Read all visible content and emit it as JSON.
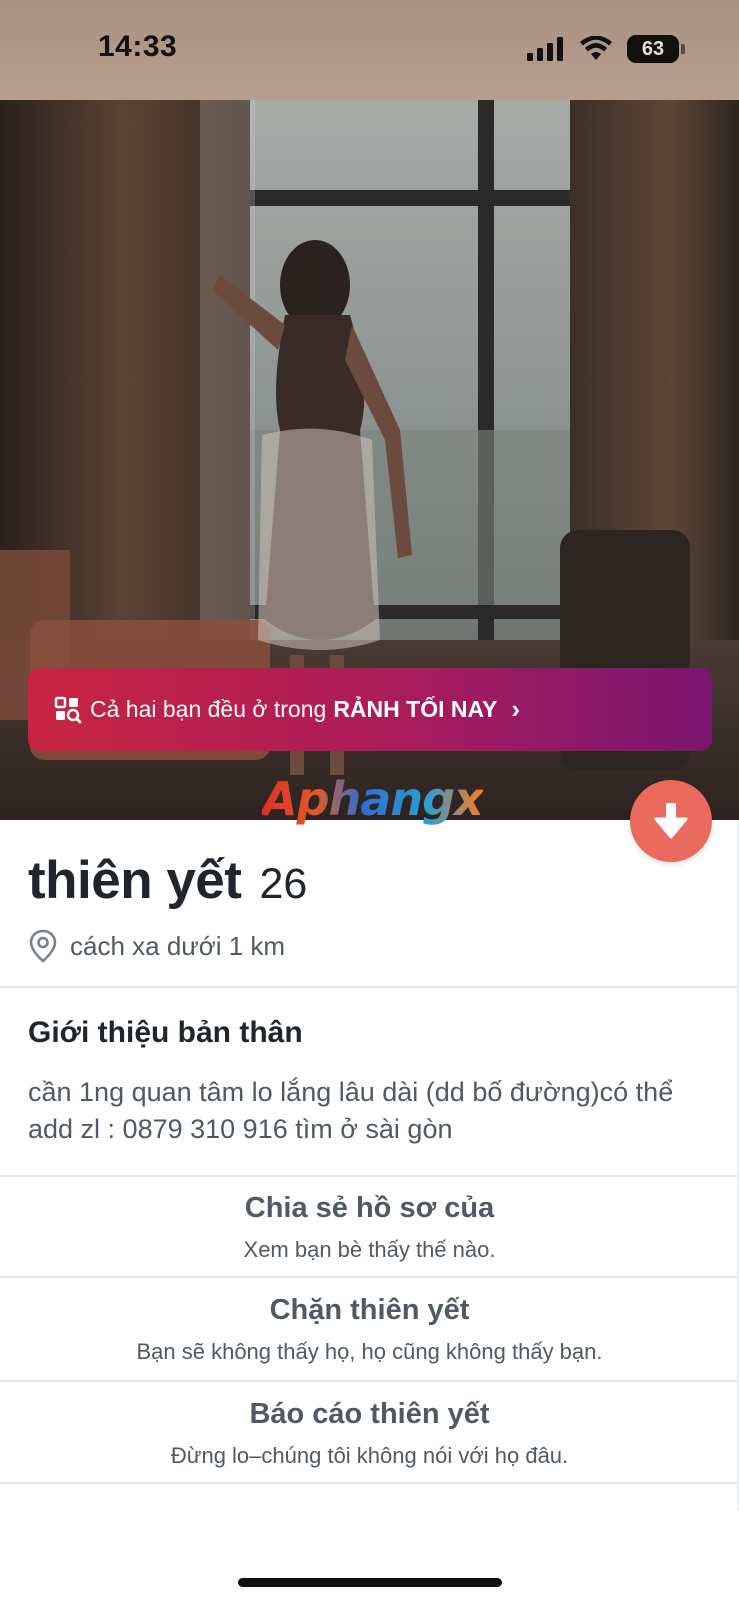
{
  "status_bar": {
    "time": "14:33",
    "battery": "63"
  },
  "promo_banner": {
    "text": "Cả hai bạn đều ở trong",
    "highlight": "RẢNH TỐI NAY",
    "chevron": "›"
  },
  "watermark": "Aphangx",
  "profile": {
    "name": "thiên yết",
    "age": "26",
    "distance": "cách xa dưới 1 km",
    "about_title": "Giới thiệu bản thân",
    "about_text": "cần 1ng quan tâm lo lắng lâu dài (dd bố đường)có thể add zl : 0879 310 916 tìm ở sài gòn"
  },
  "actions": {
    "share": {
      "title": "Chia sẻ hồ sơ của",
      "subtitle": "Xem bạn bè thấy thế nào."
    },
    "block": {
      "title": "Chặn thiên yết",
      "subtitle": "Bạn sẽ không thấy họ, họ cũng không thấy bạn."
    },
    "report": {
      "title": "Báo cáo thiên yết",
      "subtitle": "Đừng lo–chúng tôi không nói với họ đâu."
    }
  },
  "colors": {
    "accent": "#ea6a5d",
    "banner_start": "#c8243f",
    "banner_end": "#7a1670",
    "text_primary": "#21262e",
    "text_secondary": "#505965"
  },
  "icons": {
    "signal": "cellular-signal-icon",
    "wifi": "wifi-icon",
    "battery": "battery-icon",
    "promo": "search-grid-icon",
    "collapse": "arrow-down-icon",
    "location": "location-pin-icon"
  }
}
